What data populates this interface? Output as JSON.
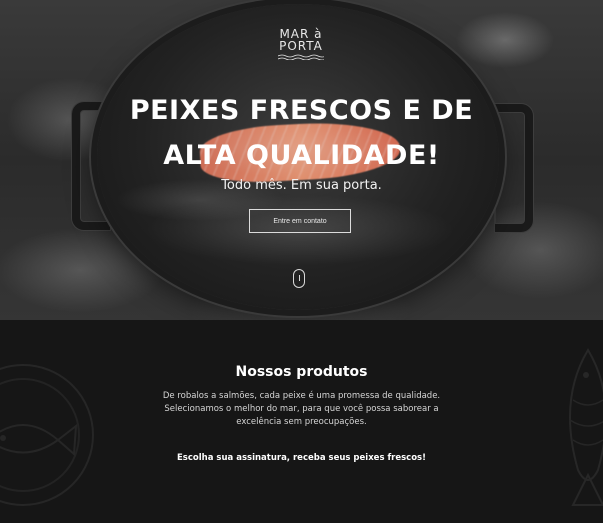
{
  "header": {
    "logo_line1": "MAR à",
    "logo_line2": "PORTA"
  },
  "hero": {
    "title_line1": "PEIXES FRESCOS E DE",
    "title_line2": "ALTA QUALIDADE!",
    "tagline": "Todo mês. Em sua porta.",
    "cta_label": "Entre em contato"
  },
  "products": {
    "heading": "Nossos produtos",
    "description": "De robalos a salmões, cada peixe é uma promessa de qualidade. Selecionamos o melhor do mar, para que você possa saborear a excelência sem preocupações.",
    "subscribe_text": "Escolha sua assinatura, receba seus peixes frescos!"
  },
  "colors": {
    "background_dark": "#151515",
    "text_light": "#ffffff",
    "accent_salmon": "#f39a76"
  }
}
